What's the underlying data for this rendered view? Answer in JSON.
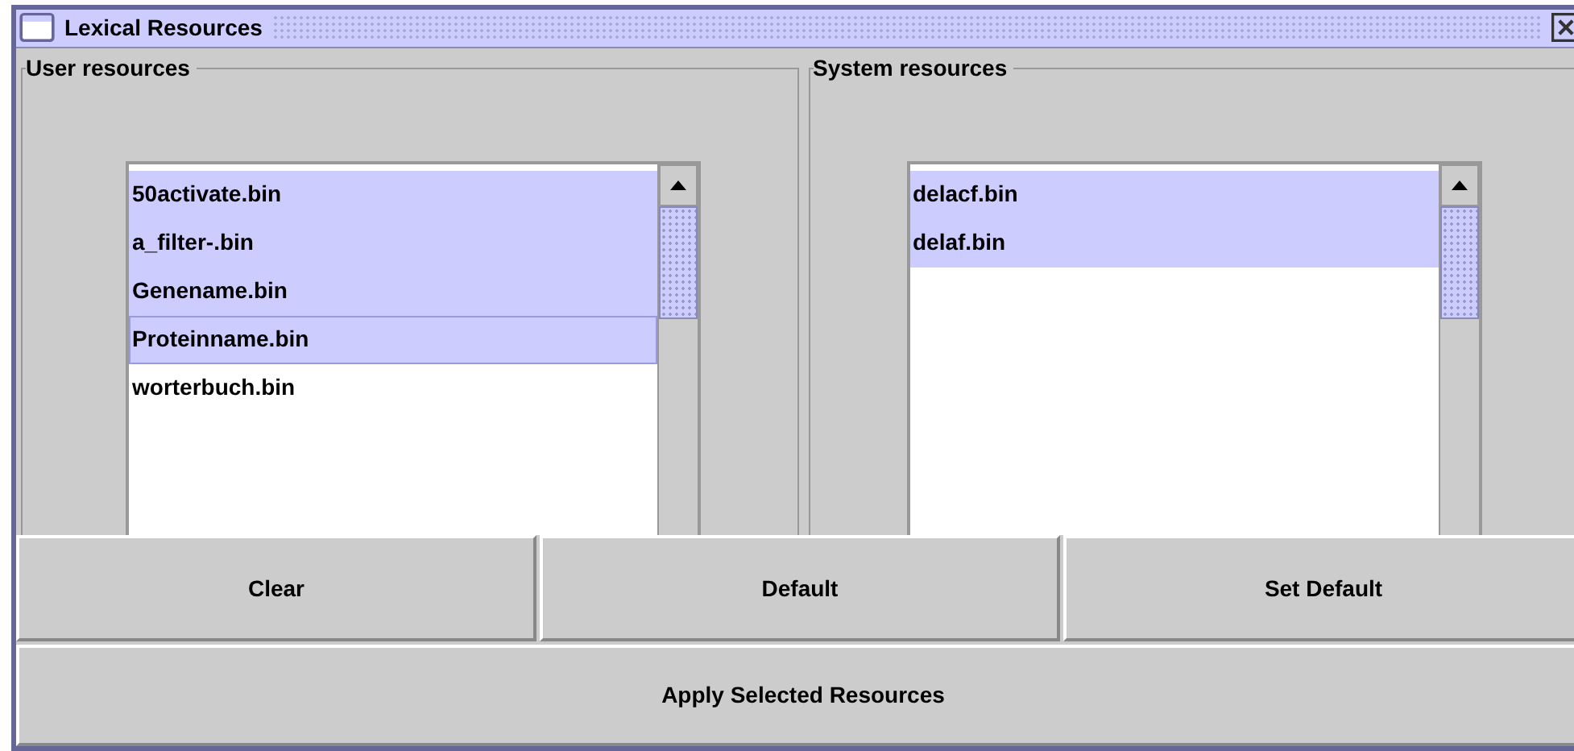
{
  "window": {
    "title": "Lexical Resources"
  },
  "panels": [
    {
      "title": "User resources",
      "items": [
        {
          "label": "50activate.bin",
          "selected": true,
          "focused": false
        },
        {
          "label": "a_filter-.bin",
          "selected": true,
          "focused": false
        },
        {
          "label": "Genename.bin",
          "selected": true,
          "focused": false
        },
        {
          "label": "Proteinname.bin",
          "selected": true,
          "focused": true
        },
        {
          "label": "worterbuch.bin",
          "selected": false,
          "focused": false
        }
      ]
    },
    {
      "title": "System resources",
      "items": [
        {
          "label": "delacf.bin",
          "selected": true,
          "focused": false
        },
        {
          "label": "delaf.bin",
          "selected": true,
          "focused": false
        }
      ]
    }
  ],
  "buttons": [
    "Clear",
    "Default",
    "Set Default"
  ],
  "apply_button": "Apply Selected Resources"
}
